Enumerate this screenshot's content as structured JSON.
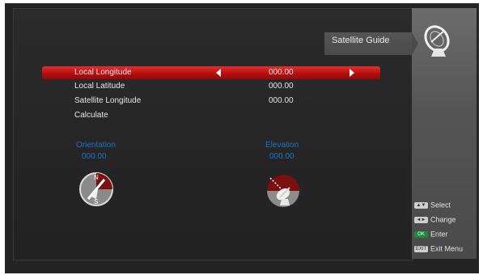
{
  "header": {
    "title": "Satellite Guide"
  },
  "menu": {
    "rows": [
      {
        "label": "Local Longitude",
        "value": "000.00"
      },
      {
        "label": "Local Latitude",
        "value": "000.00"
      },
      {
        "label": "Satellite Longitude",
        "value": "000.00"
      },
      {
        "label": "Calculate",
        "value": ""
      }
    ]
  },
  "results": {
    "orientation": {
      "label": "Orientation",
      "value": "000.00"
    },
    "elevation": {
      "label": "Elevation",
      "value": "000.00"
    }
  },
  "compass": {
    "north": "N",
    "south": "S"
  },
  "hints": [
    {
      "key": "▲▼",
      "label": "Select"
    },
    {
      "key": "◄►",
      "label": "Change"
    },
    {
      "key": "OK",
      "label": "Enter"
    },
    {
      "key": "EXIT",
      "label": "Exit Menu"
    }
  ],
  "colors": {
    "highlight": "#c41414",
    "info": "#1e73c8",
    "ok_key": "#1d8a3a"
  },
  "icons": [
    "satellite-dish-icon",
    "compass-icon",
    "elevation-icon",
    "arrow-left-icon",
    "arrow-right-icon"
  ]
}
